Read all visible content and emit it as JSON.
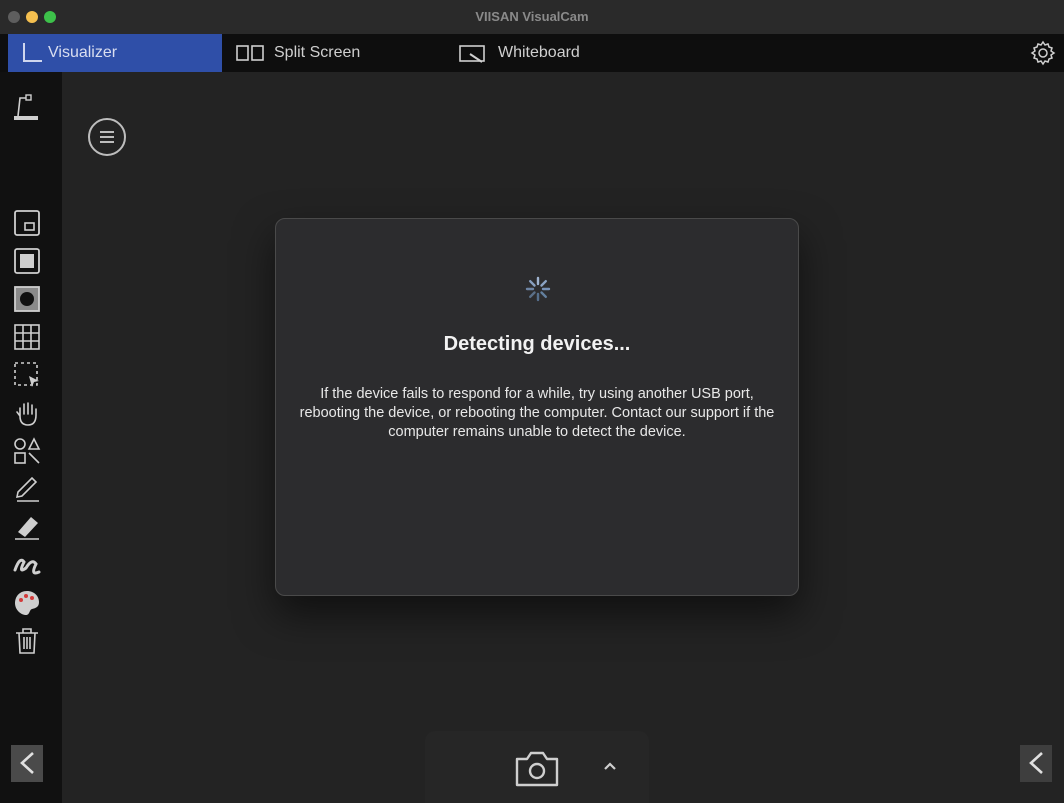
{
  "window": {
    "title": "VIISAN VisualCam"
  },
  "tabs": [
    {
      "label": "Visualizer",
      "active": true
    },
    {
      "label": "Split Screen",
      "active": false
    },
    {
      "label": "Whiteboard",
      "active": false
    }
  ],
  "dialog": {
    "title": "Detecting devices...",
    "message": "If the device fails to respond for a while, try using another USB port, rebooting the device, or rebooting the computer. Contact our support if the computer remains unable to detect the device."
  },
  "toolbar": {
    "tools": [
      "document-camera-icon",
      "picture-in-picture-icon",
      "fullscreen-icon",
      "spotlight-icon",
      "grid-icon",
      "select-icon",
      "hand-icon",
      "shapes-icon",
      "pen-icon",
      "eraser-icon",
      "marker-icon",
      "palette-icon",
      "trash-icon"
    ]
  },
  "colors": {
    "accent": "#2f4fa8",
    "background": "#232323",
    "dialog": "#2c2c2e"
  }
}
